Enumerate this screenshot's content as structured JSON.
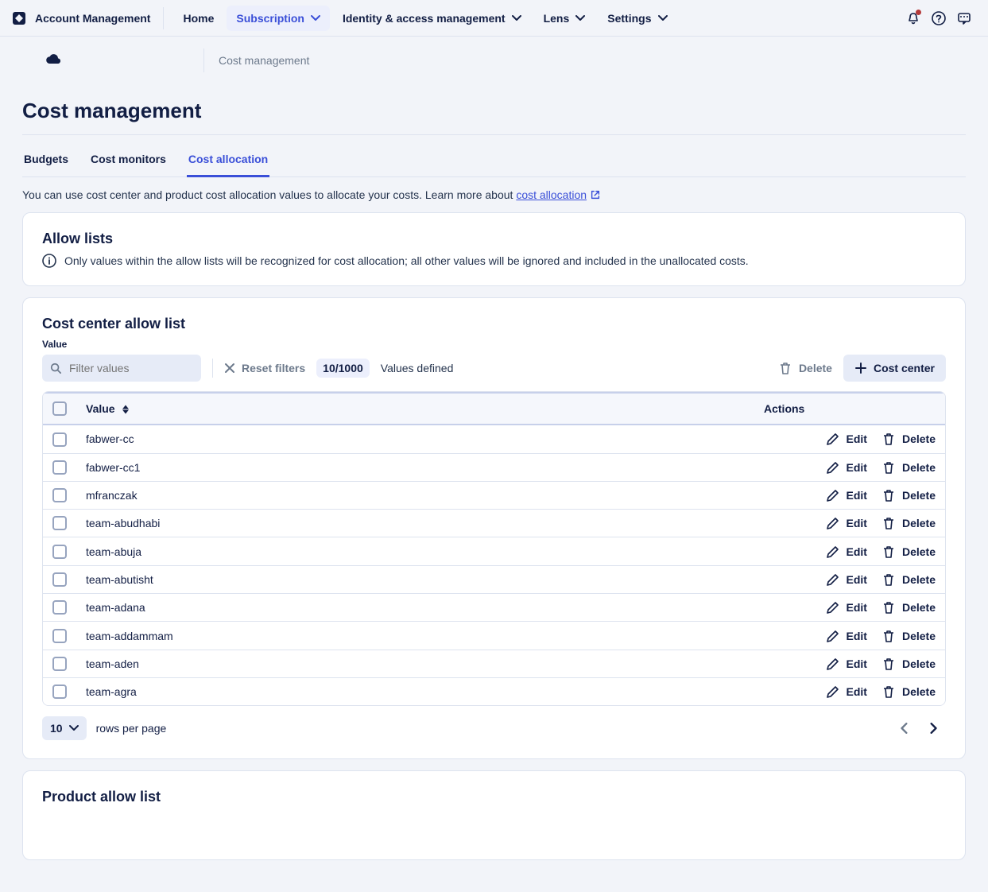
{
  "header": {
    "brand": "Account Management",
    "nav": {
      "home": "Home",
      "subscription": "Subscription",
      "iam": "Identity & access management",
      "lens": "Lens",
      "settings": "Settings"
    }
  },
  "breadcrumb": {
    "current": "Cost management"
  },
  "page": {
    "title": "Cost management"
  },
  "tabs": {
    "budgets": "Budgets",
    "monitors": "Cost monitors",
    "allocation": "Cost allocation"
  },
  "intro": {
    "text_before_link": "You can use cost center and product cost allocation values to allocate your costs. Learn more about ",
    "link_text": "cost allocation"
  },
  "allow_lists_card": {
    "title": "Allow lists",
    "info": "Only values within the allow lists will be recognized for cost allocation; all other values will be ignored and included in the unallocated costs."
  },
  "cost_center": {
    "title": "Cost center allow list",
    "filter_label": "Value",
    "filter_placeholder": "Filter values",
    "reset_filters_label": "Reset filters",
    "count_chip": "10/1000",
    "count_label": "Values defined",
    "delete_bulk_label": "Delete",
    "add_button_label": "Cost center",
    "table": {
      "col_value": "Value",
      "col_actions": "Actions",
      "edit_label": "Edit",
      "delete_label": "Delete",
      "rows": [
        {
          "value": "fabwer-cc"
        },
        {
          "value": "fabwer-cc1"
        },
        {
          "value": "mfranczak"
        },
        {
          "value": "team-abudhabi"
        },
        {
          "value": "team-abuja"
        },
        {
          "value": "team-abutisht"
        },
        {
          "value": "team-adana"
        },
        {
          "value": "team-addammam"
        },
        {
          "value": "team-aden"
        },
        {
          "value": "team-agra"
        }
      ]
    },
    "pager": {
      "page_size": "10",
      "rows_label": "rows per page"
    }
  },
  "product_list": {
    "title": "Product allow list"
  }
}
